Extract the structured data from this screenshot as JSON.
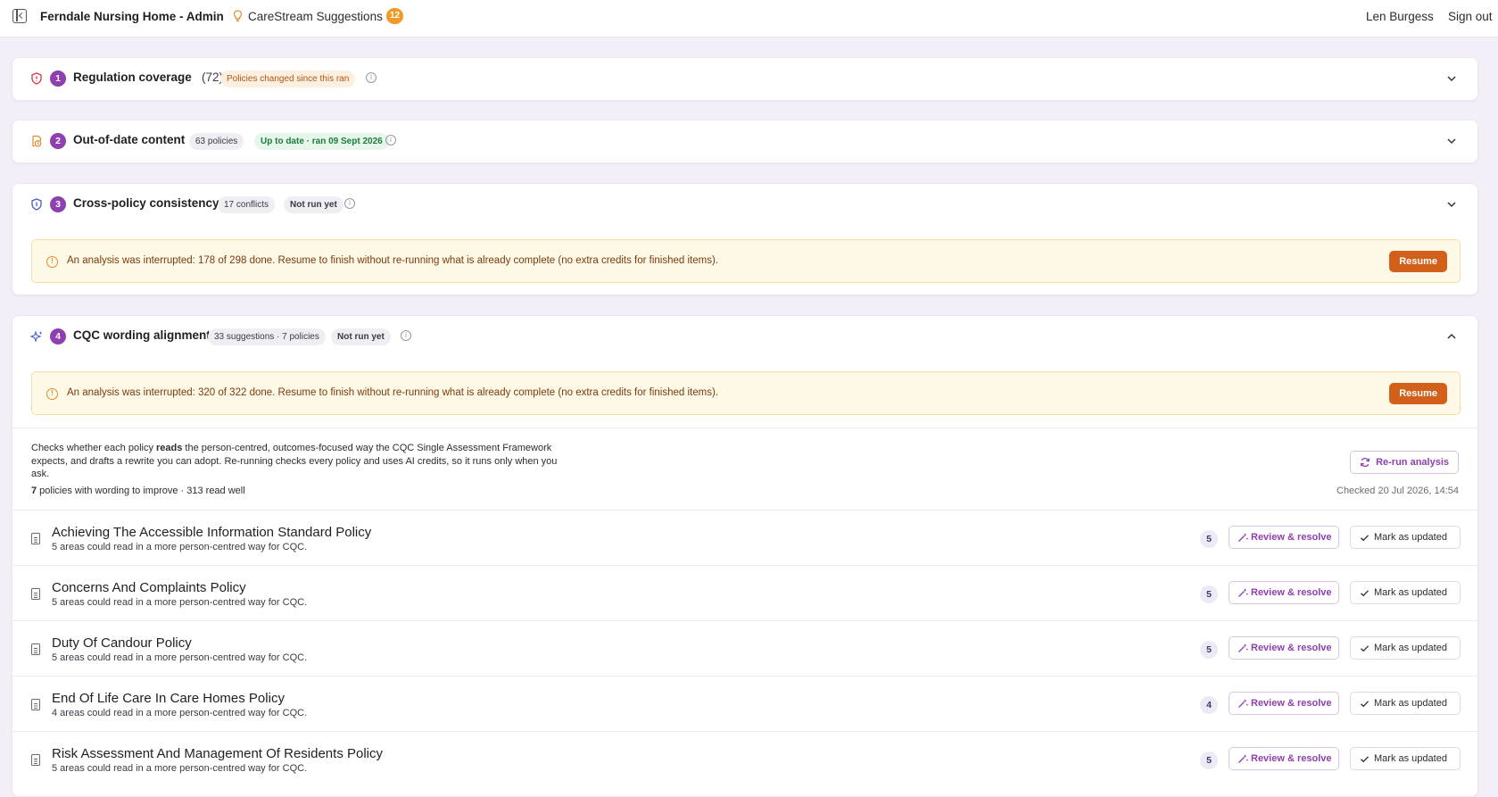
{
  "header": {
    "title": "Ferndale Nursing Home - Admin",
    "suggestions_label": "CareStream Suggestions",
    "suggestions_count": "12",
    "user_name": "Len Burgess",
    "sign_out": "Sign out"
  },
  "sections": [
    {
      "number": "1",
      "title": "Regulation coverage",
      "count": "(72)",
      "badge": "Policies changed since this ran",
      "icon": "shield-alert-icon"
    },
    {
      "number": "2",
      "title": "Out-of-date content",
      "badge": "63 policies",
      "status": "Up to date · ran 09 Sept 2026",
      "icon": "clock-document-icon"
    },
    {
      "number": "3",
      "title": "Cross-policy consistency",
      "badge": "17 conflicts",
      "status": "Not run yet",
      "icon": "shield-check-icon",
      "alert": "An analysis was interrupted: 178 of 298 done. Resume to finish without re-running what is already complete (no extra credits for finished items).",
      "resume_label": "Resume"
    },
    {
      "number": "4",
      "title": "CQC wording alignment",
      "badge": "33 suggestions · 7 policies",
      "status": "Not run yet",
      "icon": "sparkles-icon",
      "alert": "An analysis was interrupted: 320 of 322 done. Resume to finish without re-running what is already complete (no extra credits for finished items).",
      "resume_label": "Resume",
      "description_pre": "Checks whether each policy ",
      "description_bold": "reads",
      "description_post": " the person-centred, outcomes-focused way the CQC Single Assessment Framework expects, and drafts a rewrite you can adopt. Re-running checks every policy and uses AI credits, so it runs only when you ask.",
      "rerun_label": "Re-run analysis",
      "summary_count": "7",
      "summary_rest": " policies with wording to improve · 313 read well",
      "checked": "Checked 20 Jul 2026, 14:54",
      "review_label": "Review & resolve",
      "mark_label": "Mark as updated",
      "policies": [
        {
          "title": "Achieving The Accessible Information Standard Policy",
          "subtitle": "5 areas could read in a more person-centred way for CQC.",
          "count": "5"
        },
        {
          "title": "Concerns And Complaints Policy",
          "subtitle": "5 areas could read in a more person-centred way for CQC.",
          "count": "5"
        },
        {
          "title": "Duty Of Candour Policy",
          "subtitle": "5 areas could read in a more person-centred way for CQC.",
          "count": "5"
        },
        {
          "title": "End Of Life Care In Care Homes Policy",
          "subtitle": "4 areas could read in a more person-centred way for CQC.",
          "count": "4"
        },
        {
          "title": "Risk Assessment And Management Of Residents Policy",
          "subtitle": "5 areas could read in a more person-centred way for CQC.",
          "count": "5"
        }
      ]
    }
  ],
  "colors": {
    "accent": "#8e3fb0",
    "resume": "#d2601a",
    "badge_orange": "#f29a28"
  }
}
